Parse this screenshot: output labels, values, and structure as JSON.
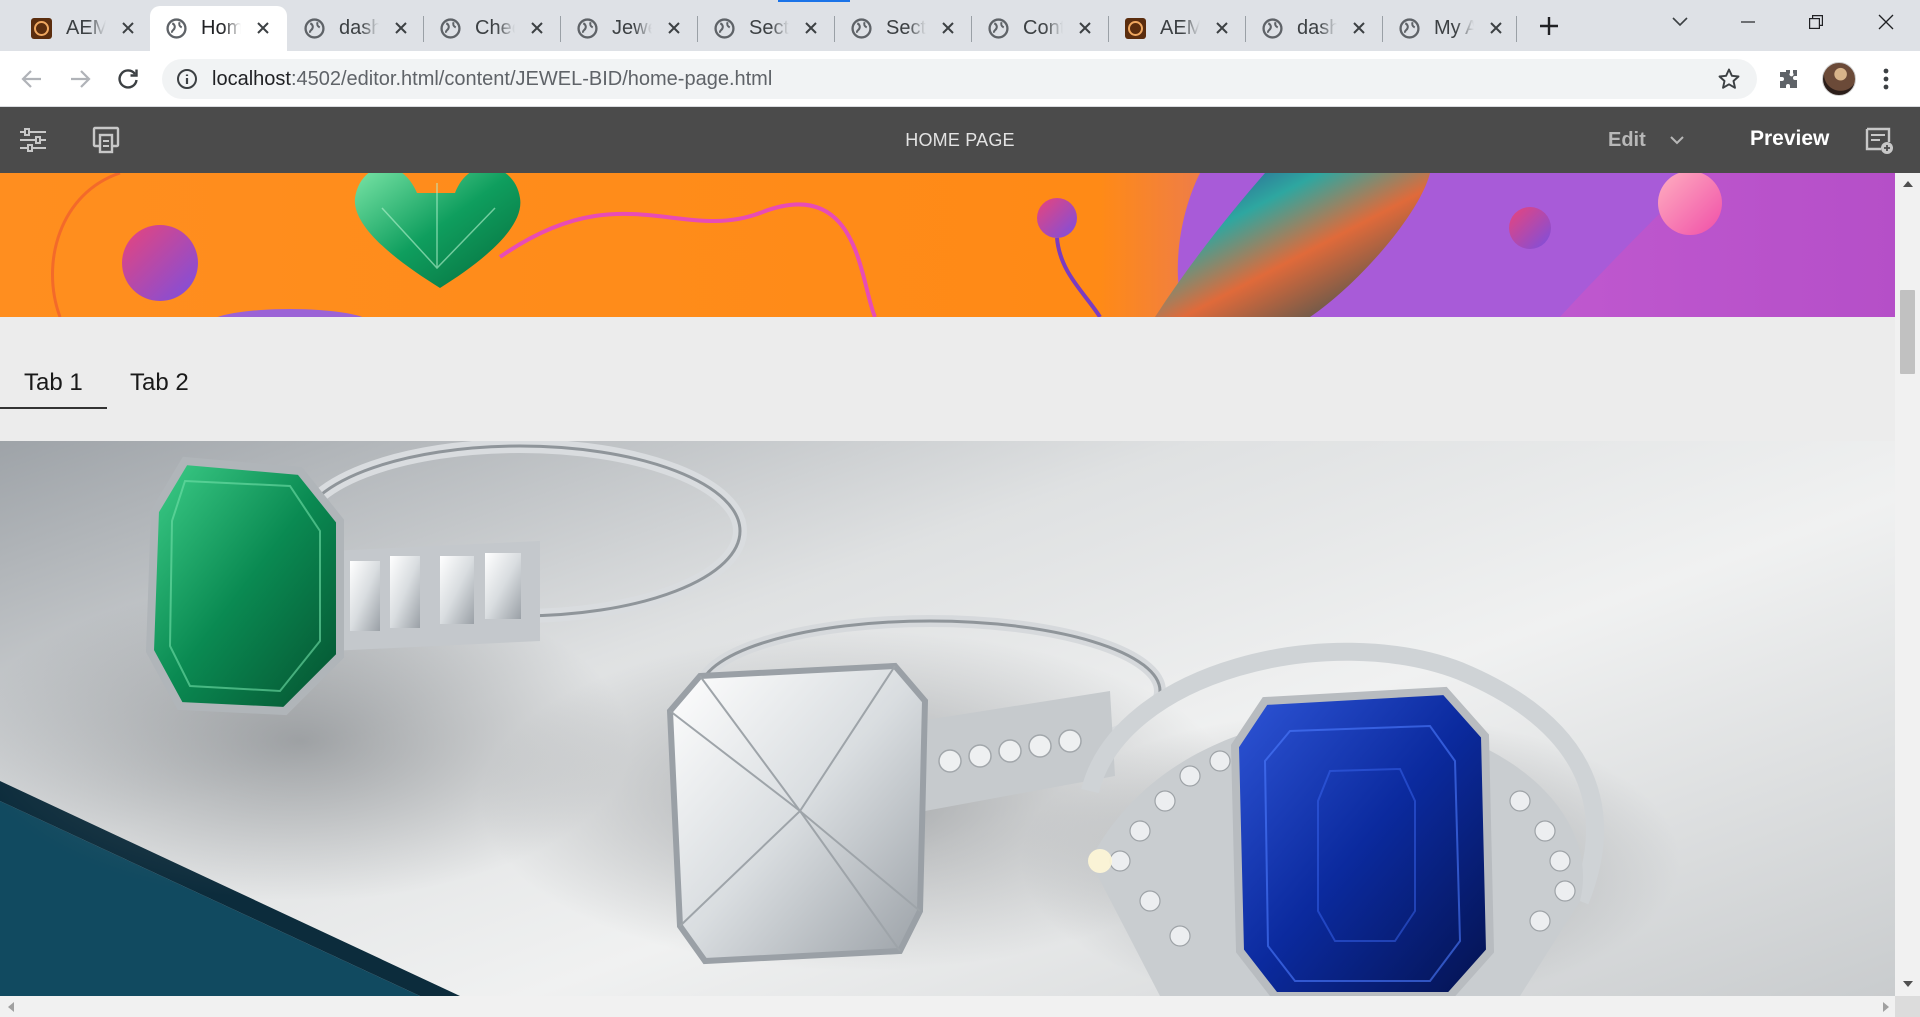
{
  "browser": {
    "tabs": [
      {
        "title": "AEM",
        "favicon": "aem-icon"
      },
      {
        "title": "Home Page",
        "favicon": "globe-icon",
        "active": true
      },
      {
        "title": "dashboard",
        "favicon": "globe-icon"
      },
      {
        "title": "Checkout",
        "favicon": "globe-icon"
      },
      {
        "title": "Jewel",
        "favicon": "globe-icon"
      },
      {
        "title": "Section",
        "favicon": "globe-icon"
      },
      {
        "title": "Section",
        "favicon": "globe-icon"
      },
      {
        "title": "Contact",
        "favicon": "globe-icon"
      },
      {
        "title": "AEM",
        "favicon": "aem-icon"
      },
      {
        "title": "dashboard",
        "favicon": "globe-icon"
      },
      {
        "title": "My Account",
        "favicon": "globe-icon"
      }
    ],
    "address_bar": {
      "host": "localhost",
      "path": ":4502/editor.html/content/JEWEL-BID/home-page.html"
    }
  },
  "editor": {
    "page_title": "HOME PAGE",
    "mode_label": "Edit",
    "preview_label": "Preview"
  },
  "page": {
    "tabs": [
      {
        "label": "Tab 1",
        "active": true
      },
      {
        "label": "Tab 2",
        "active": false
      }
    ]
  },
  "colors": {
    "editor_bar": "#4b4b4b",
    "hero_orange": "#ff8e1f",
    "hero_purple": "#b54fc8",
    "active_tab_underline": "#333333"
  }
}
